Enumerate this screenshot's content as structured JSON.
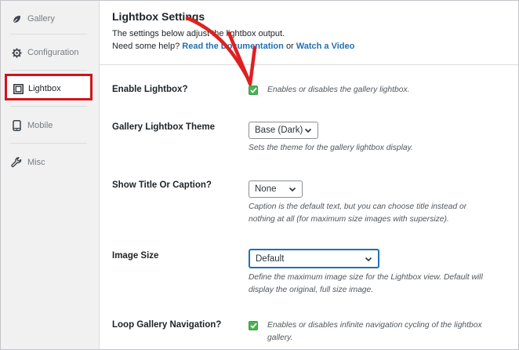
{
  "sidebar": {
    "items": [
      {
        "label": "Gallery",
        "icon": "leaf-icon"
      },
      {
        "label": "Configuration",
        "icon": "gear-icon"
      },
      {
        "label": "Lightbox",
        "icon": "lightbox-icon"
      },
      {
        "label": "Mobile",
        "icon": "mobile-icon"
      },
      {
        "label": "Misc",
        "icon": "wrench-icon"
      }
    ],
    "active": "Lightbox"
  },
  "header": {
    "title": "Lightbox Settings",
    "description": "The settings below adjust the lightbox output.",
    "help_prefix": "Need some help?",
    "docs_link": "Read the Documentation",
    "help_or": "or",
    "video_link": "Watch a Video"
  },
  "settings": {
    "enable_lightbox": {
      "label": "Enable Lightbox?",
      "checked": true,
      "help": "Enables or disables the gallery lightbox."
    },
    "theme": {
      "label": "Gallery Lightbox Theme",
      "value": "Base (Dark)",
      "help": "Sets the theme for the gallery lightbox display."
    },
    "title_caption": {
      "label": "Show Title Or Caption?",
      "value": "None",
      "help_line1": "Caption is the default text, but you can choose title instead or",
      "help_line2": "nothing at all (for maximum size images with supersize)."
    },
    "image_size": {
      "label": "Image Size",
      "value": "Default",
      "help_line1": "Define the maximum image size for the Lightbox view. Default will",
      "help_line2": "display the original, full size image."
    },
    "loop_nav": {
      "label": "Loop Gallery Navigation?",
      "checked": true,
      "help_line1": "Enables or disables infinite navigation cycling of the lightbox",
      "help_line2": "gallery."
    }
  },
  "colors": {
    "accent": "#2271b1",
    "highlight_red": "#d1141c",
    "checkbox_green": "#46b450"
  }
}
